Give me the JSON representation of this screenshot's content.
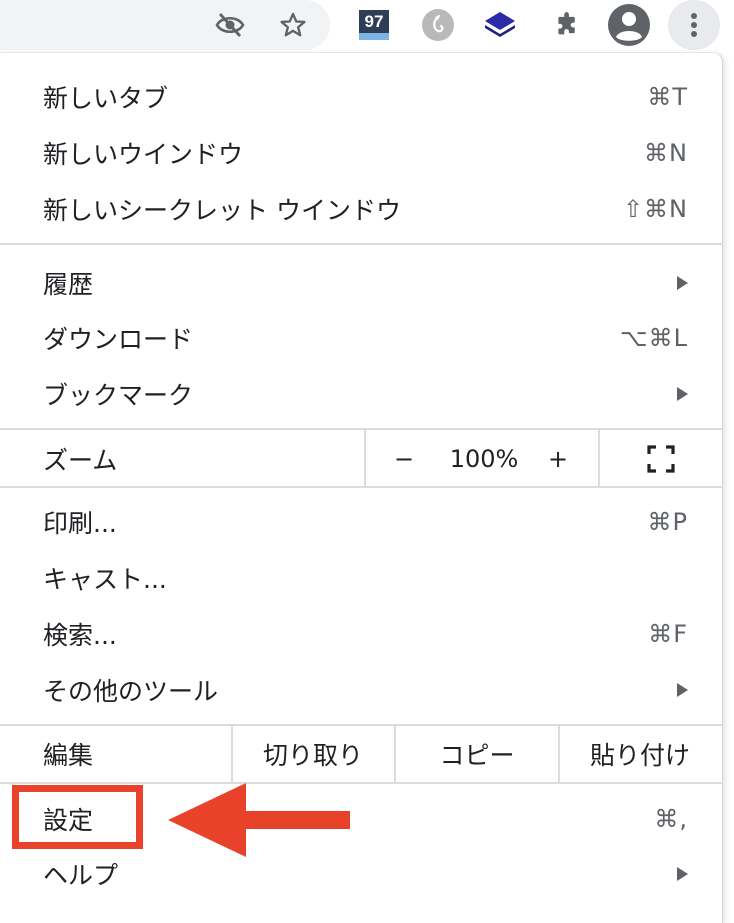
{
  "toolbar": {
    "extension_badge": "97",
    "icons": [
      "eye-slash-icon",
      "star-icon",
      "extension-97-icon",
      "extension-gray-icon",
      "extension-layers-icon",
      "puzzle-icon",
      "profile-icon",
      "more-vert-icon"
    ]
  },
  "menu": {
    "new_tab": {
      "label": "新しいタブ",
      "shortcut": "⌘T"
    },
    "new_window": {
      "label": "新しいウインドウ",
      "shortcut": "⌘N"
    },
    "new_incognito": {
      "label": "新しいシークレット ウインドウ",
      "shortcut": "⇧⌘N"
    },
    "history": {
      "label": "履歴"
    },
    "downloads": {
      "label": "ダウンロード",
      "shortcut": "⌥⌘L"
    },
    "bookmarks": {
      "label": "ブックマーク"
    },
    "zoom": {
      "label": "ズーム",
      "minus": "−",
      "value": "100%",
      "plus": "+"
    },
    "print": {
      "label": "印刷...",
      "shortcut": "⌘P"
    },
    "cast": {
      "label": "キャスト..."
    },
    "find": {
      "label": "検索...",
      "shortcut": "⌘F"
    },
    "more_tools": {
      "label": "その他のツール"
    },
    "edit": {
      "label": "編集",
      "cut": "切り取り",
      "copy": "コピー",
      "paste": "貼り付け"
    },
    "settings": {
      "label": "設定",
      "shortcut": "⌘,"
    },
    "help": {
      "label": "ヘルプ"
    }
  },
  "annotation": {
    "color": "#e8432a"
  }
}
